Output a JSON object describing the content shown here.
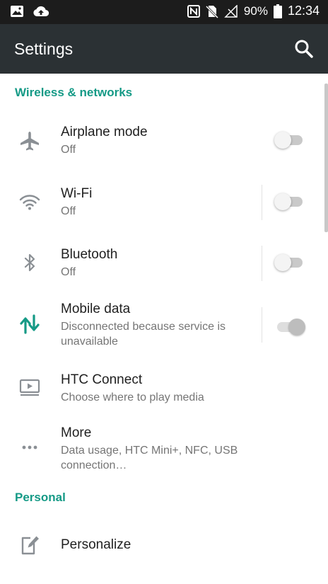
{
  "status_bar": {
    "battery_percent": "90%",
    "time": "12:34"
  },
  "app_bar": {
    "title": "Settings"
  },
  "sections": {
    "wireless": {
      "header": "Wireless & networks",
      "items": [
        {
          "label": "Airplane mode",
          "summary": "Off",
          "toggle": "off"
        },
        {
          "label": "Wi-Fi",
          "summary": "Off",
          "toggle": "off"
        },
        {
          "label": "Bluetooth",
          "summary": "Off",
          "toggle": "off"
        },
        {
          "label": "Mobile data",
          "summary_line1": "Disconnected because service is",
          "summary_line2": "unavailable",
          "toggle": "on-disabled"
        },
        {
          "label": "HTC Connect",
          "summary": "Choose where to play media"
        },
        {
          "label": "More",
          "summary_line1": "Data usage, HTC Mini+, NFC, USB",
          "summary_line2": "connection…"
        }
      ]
    },
    "personal": {
      "header": "Personal",
      "items": [
        {
          "label": "Personalize"
        }
      ]
    }
  },
  "colors": {
    "accent": "#159a86",
    "app_bar": "#2b3134",
    "status_bar": "#1c1c1c",
    "icon_gray": "#8a8f94"
  }
}
